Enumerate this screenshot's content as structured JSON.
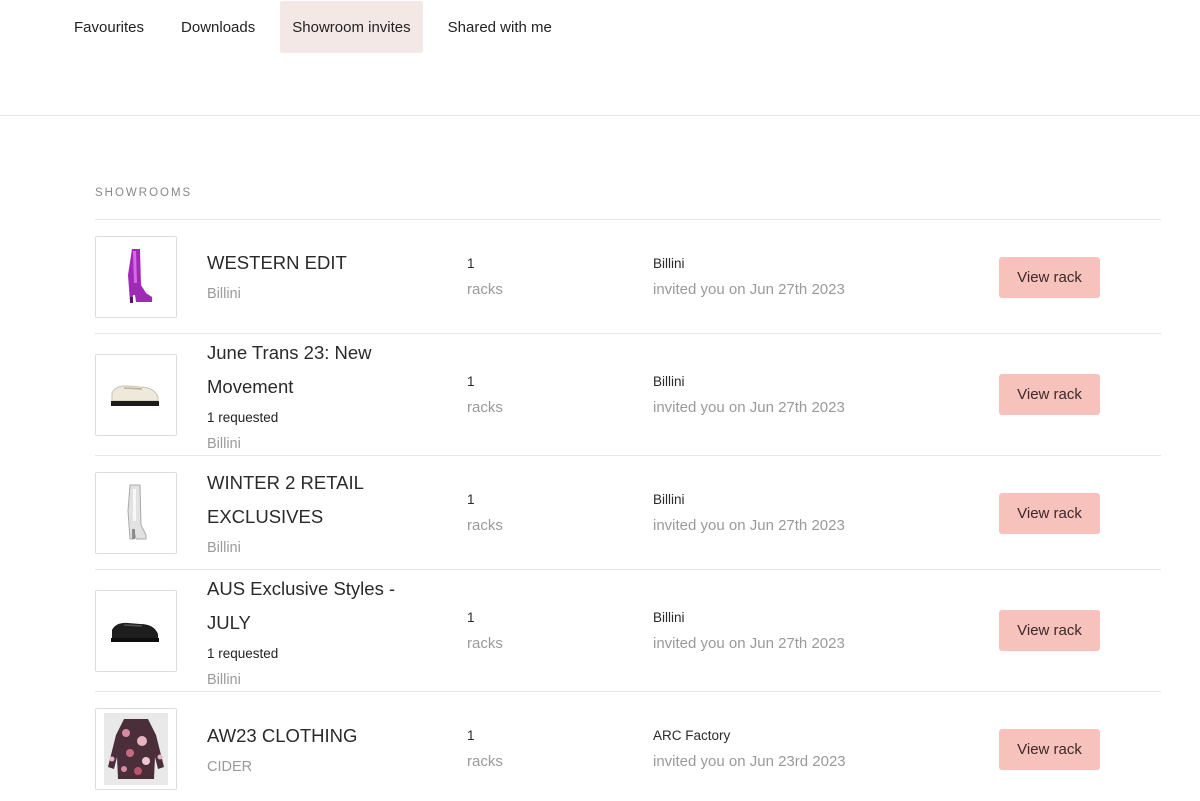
{
  "tabs": [
    {
      "label": "Favourites",
      "active": false
    },
    {
      "label": "Downloads",
      "active": false
    },
    {
      "label": "Showroom invites",
      "active": true
    },
    {
      "label": "Shared with me",
      "active": false
    }
  ],
  "section_title": "SHOWROOMS",
  "showrooms": [
    {
      "title": "WESTERN EDIT",
      "requested": "",
      "brand": "Billini",
      "rack_count": "1",
      "rack_label": "racks",
      "invited_by": "Billini",
      "invited_on": "invited you on Jun 27th 2023",
      "button": "View rack",
      "thumb": "boot-icon"
    },
    {
      "title": "June Trans 23: New Movement",
      "requested": "1 requested",
      "brand": "Billini",
      "rack_count": "1",
      "rack_label": "racks",
      "invited_by": "Billini",
      "invited_on": "invited you on Jun 27th 2023",
      "button": "View rack",
      "thumb": "loafer-icon"
    },
    {
      "title": "WINTER 2 RETAIL EXCLUSIVES",
      "requested": "",
      "brand": "Billini",
      "rack_count": "1",
      "rack_label": "racks",
      "invited_by": "Billini",
      "invited_on": "invited you on Jun 27th 2023",
      "button": "View rack",
      "thumb": "silver-boot-icon"
    },
    {
      "title": "AUS Exclusive Styles - JULY",
      "requested": "1 requested",
      "brand": "Billini",
      "rack_count": "1",
      "rack_label": "racks",
      "invited_by": "Billini",
      "invited_on": "invited you on Jun 27th 2023",
      "button": "View rack",
      "thumb": "black-loafer-icon"
    },
    {
      "title": "AW23 CLOTHING",
      "requested": "",
      "brand": "CIDER",
      "rack_count": "1",
      "rack_label": "racks",
      "invited_by": "ARC Factory",
      "invited_on": "invited you on Jun 23rd 2023",
      "button": "View rack",
      "thumb": "floral-top-icon"
    }
  ],
  "colors": {
    "accent": "#f7c1bc",
    "active_tab": "#f3e8e5",
    "muted": "#9a9a9a"
  }
}
